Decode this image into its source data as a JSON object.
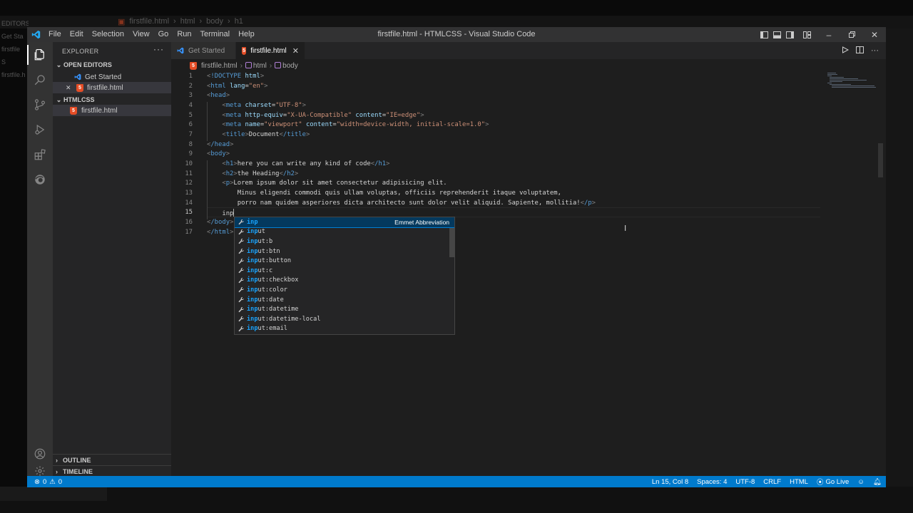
{
  "background": {
    "ghost_breadcrumb": [
      "firstfile.html",
      "html",
      "body",
      "h1"
    ],
    "ghost_sidebar": [
      "EDITORS",
      "Get Sta",
      "firstfile",
      "S",
      "firstfile.h"
    ]
  },
  "window": {
    "title": "firstfile.html - HTMLCSS - Visual Studio Code",
    "menu": [
      "File",
      "Edit",
      "Selection",
      "View",
      "Go",
      "Run",
      "Terminal",
      "Help"
    ]
  },
  "activity_bar": [
    "explorer-icon",
    "search-icon",
    "source-control-icon",
    "run-debug-icon",
    "extensions-icon",
    "edge-icon",
    "account-icon",
    "settings-gear-icon"
  ],
  "sidebar": {
    "title": "EXPLORER",
    "more": "···",
    "open_editors_label": "OPEN EDITORS",
    "open_editors": [
      {
        "name": "Get Started",
        "icon": "vscode-icon"
      },
      {
        "name": "firstfile.html",
        "icon": "html5-icon",
        "close": "✕"
      }
    ],
    "folder_label": "HTMLCSS",
    "files": [
      {
        "name": "firstfile.html",
        "icon": "html5-icon"
      }
    ],
    "outline_label": "OUTLINE",
    "timeline_label": "TIMELINE"
  },
  "tabs": [
    {
      "label": "Get Started",
      "active": false
    },
    {
      "label": "firstfile.html",
      "active": true,
      "close": "✕"
    }
  ],
  "breadcrumb": [
    "firstfile.html",
    "html",
    "body"
  ],
  "editor": {
    "current_line": 15,
    "line_numbers": [
      "1",
      "2",
      "3",
      "4",
      "5",
      "6",
      "7",
      "8",
      "9",
      "10",
      "11",
      "12",
      "13",
      "14",
      "15",
      "16",
      "17"
    ],
    "lines": [
      "<!DOCTYPE html>",
      "<html lang=\"en\">",
      "<head>",
      "    <meta charset=\"UTF-8\">",
      "    <meta http-equiv=\"X-UA-Compatible\" content=\"IE=edge\">",
      "    <meta name=\"viewport\" content=\"width=device-width, initial-scale=1.0\">",
      "    <title>Document</title>",
      "</head>",
      "<body>",
      "    <h1>here you can write any kind of code</h1>",
      "    <h2>the Heading</h2>",
      "    <p>Lorem ipsum dolor sit amet consectetur adipisicing elit.",
      "        Minus eligendi commodi quis ullam voluptas, officiis reprehenderit itaque voluptatem,",
      "        porro nam quidem asperiores dicta architecto sunt dolor velit aliquid. Sapiente, mollitia!</p>",
      "    inp",
      "</body>",
      "</html>"
    ]
  },
  "suggest": {
    "typed": "inp",
    "detail": "Emmet Abbreviation",
    "items": [
      "inp",
      "input",
      "input:b",
      "input:btn",
      "input:button",
      "input:c",
      "input:checkbox",
      "input:color",
      "input:date",
      "input:datetime",
      "input:datetime-local",
      "input:email"
    ]
  },
  "status_bar": {
    "errors": "0",
    "warnings": "0",
    "position": "Ln 15, Col 8",
    "spaces": "Spaces: 4",
    "encoding": "UTF-8",
    "eol": "CRLF",
    "language": "HTML",
    "go_live": "Go Live"
  },
  "colors": {
    "accent": "#007acc",
    "title_bar": "#323233",
    "editor_bg": "#1e1e1e",
    "sidebar_bg": "#252526",
    "activity_bar": "#333333",
    "html_icon": "#e44d26",
    "suggest_focus": "#04395e",
    "suggest_match": "#18a3ff"
  }
}
